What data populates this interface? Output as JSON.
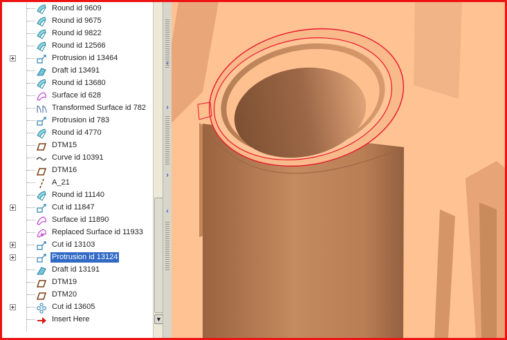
{
  "model_tree": {
    "items": [
      {
        "label": "Round id 9609",
        "icon": "round-icon",
        "expandable": false,
        "selected": false
      },
      {
        "label": "Round id 9675",
        "icon": "round-icon",
        "expandable": false,
        "selected": false
      },
      {
        "label": "Round id 9822",
        "icon": "round-icon",
        "expandable": false,
        "selected": false
      },
      {
        "label": "Round id 12566",
        "icon": "round-icon",
        "expandable": false,
        "selected": false
      },
      {
        "label": "Protrusion id 13464",
        "icon": "protrusion-icon",
        "expandable": true,
        "selected": false
      },
      {
        "label": "Draft id 13491",
        "icon": "draft-icon",
        "expandable": false,
        "selected": false
      },
      {
        "label": "Round id 13680",
        "icon": "round-icon",
        "expandable": false,
        "selected": false
      },
      {
        "label": "Surface id 628",
        "icon": "surface-icon",
        "expandable": false,
        "selected": false
      },
      {
        "label": "Transformed Surface id 782",
        "icon": "transformed-surface-icon",
        "expandable": false,
        "selected": false
      },
      {
        "label": "Protrusion id 783",
        "icon": "protrusion-icon",
        "expandable": false,
        "selected": false
      },
      {
        "label": "Round id 4770",
        "icon": "round-icon",
        "expandable": false,
        "selected": false
      },
      {
        "label": "DTM15",
        "icon": "datum-plane-icon",
        "expandable": false,
        "selected": false
      },
      {
        "label": "Curve id 10391",
        "icon": "curve-icon",
        "expandable": false,
        "selected": false
      },
      {
        "label": "DTM16",
        "icon": "datum-plane-icon",
        "expandable": false,
        "selected": false
      },
      {
        "label": "A_21",
        "icon": "datum-axis-icon",
        "expandable": false,
        "selected": false
      },
      {
        "label": "Round id 11140",
        "icon": "round-icon",
        "expandable": false,
        "selected": false
      },
      {
        "label": "Cut id 11847",
        "icon": "cut-icon",
        "expandable": true,
        "selected": false
      },
      {
        "label": "Surface id 11890",
        "icon": "surface-icon",
        "expandable": false,
        "selected": false
      },
      {
        "label": "Replaced Surface id 11933",
        "icon": "replaced-surface-icon",
        "expandable": false,
        "selected": false
      },
      {
        "label": "Cut id 13103",
        "icon": "cut-icon",
        "expandable": true,
        "selected": false
      },
      {
        "label": "Protrusion id 13124",
        "icon": "protrusion-icon",
        "expandable": true,
        "selected": true
      },
      {
        "label": "Draft id 13191",
        "icon": "draft-icon",
        "expandable": false,
        "selected": false
      },
      {
        "label": "DTM19",
        "icon": "datum-plane-icon",
        "expandable": false,
        "selected": false
      },
      {
        "label": "DTM20",
        "icon": "datum-plane-icon",
        "expandable": false,
        "selected": false
      },
      {
        "label": "Cut id 13605",
        "icon": "pattern-cut-icon",
        "expandable": true,
        "selected": false
      },
      {
        "label": "Insert Here",
        "icon": "insert-here-icon",
        "expandable": false,
        "selected": false
      }
    ]
  },
  "colors": {
    "frame_border": "#ee1111",
    "selection": "#316ac5",
    "model_surface": "#ffc293",
    "model_shadow": "#9c6540",
    "highlight_edge": "#e8162c",
    "round_icon": "#3aa2b8",
    "surface_icon": "#c24fd1",
    "insert_arrow": "#d61a1a"
  }
}
